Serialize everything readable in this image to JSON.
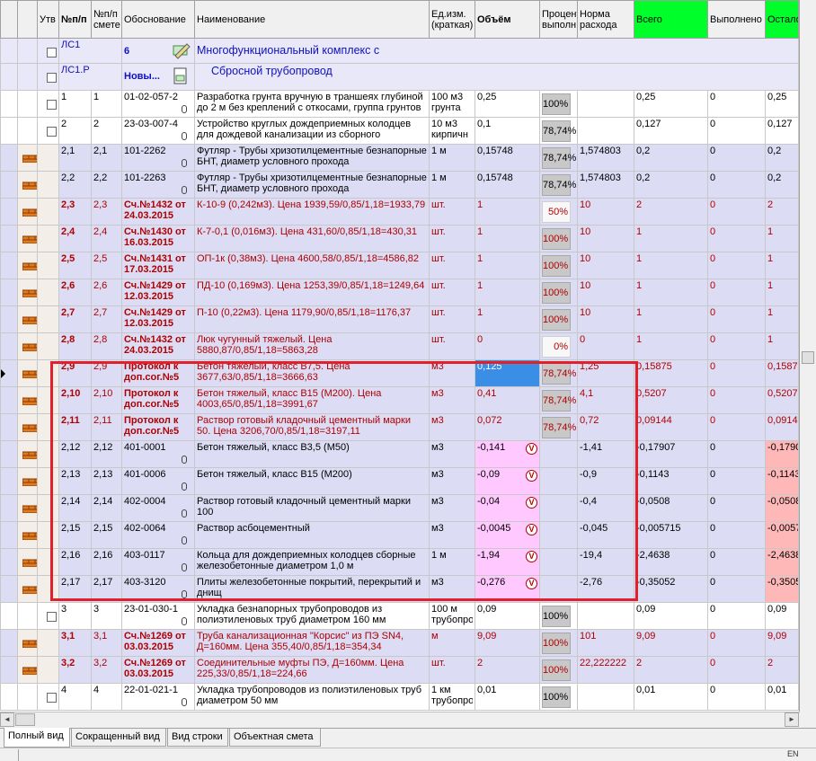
{
  "columns": [
    "Утв",
    "№п/п",
    "№п/п смете",
    "Обоснование",
    "Наименование",
    "Ед.изм. (краткая)",
    "Объём",
    "Процент выполн",
    "Норма расхода",
    "Всего",
    "Выполнено",
    "Осталось"
  ],
  "sections": [
    {
      "code": "ЛС1",
      "num": "6",
      "title": "Многофункциональный комплекс с"
    },
    {
      "code": "ЛС1.Р",
      "num": "Новы...",
      "title": "Сбросной трубопровод"
    }
  ],
  "rows": [
    {
      "kind": "work",
      "a": "1",
      "b": "1",
      "just": "01-02-057-2",
      "name": "Разработка грунта вручную в траншеях глубиной до 2 м без креплений с откосами, группа грунтов",
      "unit": "100 м3 грунта",
      "vol": "0,25",
      "pct": "100%",
      "norm": "",
      "tot": "0,25",
      "done": "0",
      "rest": "0,25"
    },
    {
      "kind": "work",
      "a": "2",
      "b": "2",
      "just": "23-03-007-4",
      "name": "Устройство круглых дождеприемных колодцев для дождевой канализации из сборного",
      "unit": "10 м3 кирпичн",
      "vol": "0,1",
      "pct": "78,74%",
      "norm": "",
      "tot": "0,127",
      "done": "0",
      "rest": "0,127"
    },
    {
      "kind": "mat",
      "a": "2,1",
      "b": "2,1",
      "just": "101-2262",
      "name": "Футляр - Трубы хризотилцементные безнапорные БНТ, диаметр условного прохода",
      "unit": "1 м",
      "vol": "0,15748",
      "pct": "78,74%",
      "norm": "1,574803",
      "tot": "0,2",
      "done": "0",
      "rest": "0,2"
    },
    {
      "kind": "mat",
      "a": "2,2",
      "b": "2,2",
      "just": "101-2263",
      "name": "Футляр - Трубы хризотилцементные безнапорные БНТ, диаметр условного прохода",
      "unit": "1 м",
      "vol": "0,15748",
      "pct": "78,74%",
      "norm": "1,574803",
      "tot": "0,2",
      "done": "0",
      "rest": "0,2"
    },
    {
      "kind": "red",
      "a": "2,3",
      "b": "2,3",
      "just": "Сч.№1432 от 24.03.2015",
      "name": "К-10-9 (0,242м3). Цена 1939,59/0,85/1,18=1933,79",
      "unit": "шт.",
      "vol": "1",
      "pct": "50%",
      "norm": "10",
      "tot": "2",
      "done": "0",
      "rest": "2"
    },
    {
      "kind": "red",
      "a": "2,4",
      "b": "2,4",
      "just": "Сч.№1430 от 16.03.2015",
      "name": "К-7-0,1 (0,016м3). Цена 431,60/0,85/1,18=430,31",
      "unit": "шт.",
      "vol": "1",
      "pct": "100%",
      "norm": "10",
      "tot": "1",
      "done": "0",
      "rest": "1"
    },
    {
      "kind": "red",
      "a": "2,5",
      "b": "2,5",
      "just": "Сч.№1431 от 17.03.2015",
      "name": "ОП-1к (0,38м3). Цена 4600,58/0,85/1,18=4586,82",
      "unit": "шт.",
      "vol": "1",
      "pct": "100%",
      "norm": "10",
      "tot": "1",
      "done": "0",
      "rest": "1"
    },
    {
      "kind": "red",
      "a": "2,6",
      "b": "2,6",
      "just": "Сч.№1429 от 12.03.2015",
      "name": "ПД-10 (0,169м3). Цена 1253,39/0,85/1,18=1249,64",
      "unit": "шт.",
      "vol": "1",
      "pct": "100%",
      "norm": "10",
      "tot": "1",
      "done": "0",
      "rest": "1"
    },
    {
      "kind": "red",
      "a": "2,7",
      "b": "2,7",
      "just": "Сч.№1429 от 12.03.2015",
      "name": "П-10 (0,22м3). Цена 1179,90/0,85/1,18=1176,37",
      "unit": "шт.",
      "vol": "1",
      "pct": "100%",
      "norm": "10",
      "tot": "1",
      "done": "0",
      "rest": "1"
    },
    {
      "kind": "red",
      "a": "2,8",
      "b": "2,8",
      "just": "Сч.№1432 от 24.03.2015",
      "name": "Люк чугунный тяжелый. Цена 5880,87/0,85/1,18=5863,28",
      "unit": "шт.",
      "vol": "0",
      "pct": "0%",
      "norm": "0",
      "tot": "1",
      "done": "0",
      "rest": "1"
    },
    {
      "kind": "red",
      "a": "2,9",
      "b": "2,9",
      "just": "Протокол к доп.сог.№5",
      "name": "Бетон тяжелый, класс В7,5. Цена 3677,63/0,85/1,18=3666,63",
      "unit": "м3",
      "vol": "0,125",
      "pct": "78,74%",
      "norm": "1,25",
      "tot": "0,15875",
      "done": "0",
      "rest": "0,1587",
      "current": true
    },
    {
      "kind": "red",
      "a": "2,10",
      "b": "2,10",
      "just": "Протокол к доп.сог.№5",
      "name": "Бетон тяжелый, класс В15 (М200). Цена 4003,65/0,85/1,18=3991,67",
      "unit": "м3",
      "vol": "0,41",
      "pct": "78,74%",
      "norm": "4,1",
      "tot": "0,5207",
      "done": "0",
      "rest": "0,5207"
    },
    {
      "kind": "red",
      "a": "2,11",
      "b": "2,11",
      "just": "Протокол к доп.сог.№5",
      "name": "Раствор готовый кладочный цементный марки 50. Цена 3206,70/0,85/1,18=3197,11",
      "unit": "м3",
      "vol": "0,072",
      "pct": "78,74%",
      "norm": "0,72",
      "tot": "0,09144",
      "done": "0",
      "rest": "0,0914"
    },
    {
      "kind": "neg",
      "a": "2,12",
      "b": "2,12",
      "just": "401-0001",
      "name": "Бетон тяжелый, класс В3,5 (М50)",
      "unit": "м3",
      "vol": "-0,141",
      "pct": "",
      "norm": "-1,41",
      "tot": "-0,17907",
      "done": "0",
      "rest": "-0,1790"
    },
    {
      "kind": "neg",
      "a": "2,13",
      "b": "2,13",
      "just": "401-0006",
      "name": "Бетон тяжелый, класс В15 (М200)",
      "unit": "м3",
      "vol": "-0,09",
      "pct": "",
      "norm": "-0,9",
      "tot": "-0,1143",
      "done": "0",
      "rest": "-0,1143"
    },
    {
      "kind": "neg",
      "a": "2,14",
      "b": "2,14",
      "just": "402-0004",
      "name": "Раствор готовый кладочный цементный марки 100",
      "unit": "м3",
      "vol": "-0,04",
      "pct": "",
      "norm": "-0,4",
      "tot": "-0,0508",
      "done": "0",
      "rest": "-0,0508"
    },
    {
      "kind": "neg",
      "a": "2,15",
      "b": "2,15",
      "just": "402-0064",
      "name": "Раствор асбоцементный",
      "unit": "м3",
      "vol": "-0,0045",
      "pct": "",
      "norm": "-0,045",
      "tot": "-0,005715",
      "done": "0",
      "rest": "-0,0057"
    },
    {
      "kind": "neg",
      "a": "2,16",
      "b": "2,16",
      "just": "403-0117",
      "name": "Кольца для дождеприемных колодцев сборные железобетонные диаметром 1,0 м",
      "unit": "1 м",
      "vol": "-1,94",
      "pct": "",
      "norm": "-19,4",
      "tot": "-2,4638",
      "done": "0",
      "rest": "-2,4638"
    },
    {
      "kind": "neg",
      "a": "2,17",
      "b": "2,17",
      "just": "403-3120",
      "name": "Плиты железобетонные покрытий, перекрытий и днищ",
      "unit": "м3",
      "vol": "-0,276",
      "pct": "",
      "norm": "-2,76",
      "tot": "-0,35052",
      "done": "0",
      "rest": "-0,3505"
    },
    {
      "kind": "work",
      "a": "3",
      "b": "3",
      "just": "23-01-030-1",
      "name": "Укладка безнапорных трубопроводов из полиэтиленовых труб диаметром 160 мм",
      "unit": "100 м трубопро",
      "vol": "0,09",
      "pct": "100%",
      "norm": "",
      "tot": "0,09",
      "done": "0",
      "rest": "0,09"
    },
    {
      "kind": "red",
      "a": "3,1",
      "b": "3,1",
      "just": "Сч.№1269 от 03.03.2015",
      "name": "Труба канализационная \"Корсис\" из ПЭ SN4, Д=160мм. Цена 355,40/0,85/1,18=354,34",
      "unit": "м",
      "vol": "9,09",
      "pct": "100%",
      "norm": "101",
      "tot": "9,09",
      "done": "0",
      "rest": "9,09"
    },
    {
      "kind": "red",
      "a": "3,2",
      "b": "3,2",
      "just": "Сч.№1269 от 03.03.2015",
      "name": "Соединительные муфты ПЭ, Д=160мм. Цена 225,33/0,85/1,18=224,66",
      "unit": "шт.",
      "vol": "2",
      "pct": "100%",
      "norm": "22,222222",
      "tot": "2",
      "done": "0",
      "rest": "2"
    },
    {
      "kind": "work",
      "a": "4",
      "b": "4",
      "just": "22-01-021-1",
      "name": "Укладка трубопроводов из полиэтиленовых труб диаметром 50 мм",
      "unit": "1 км трубопро",
      "vol": "0,01",
      "pct": "100%",
      "norm": "",
      "tot": "0,01",
      "done": "0",
      "rest": "0,01"
    }
  ],
  "tabs": [
    "Полный вид",
    "Сокращенный вид",
    "Вид строки",
    "Объектная смета"
  ],
  "status": {
    "lang": "EN"
  },
  "colors": {
    "header_total": "#00ff2a",
    "highlight_box": "#e0202a",
    "material_row": "#dcdcf4",
    "negative_cell": "#ffc8ff",
    "rest_negative": "#ffb8b8"
  }
}
